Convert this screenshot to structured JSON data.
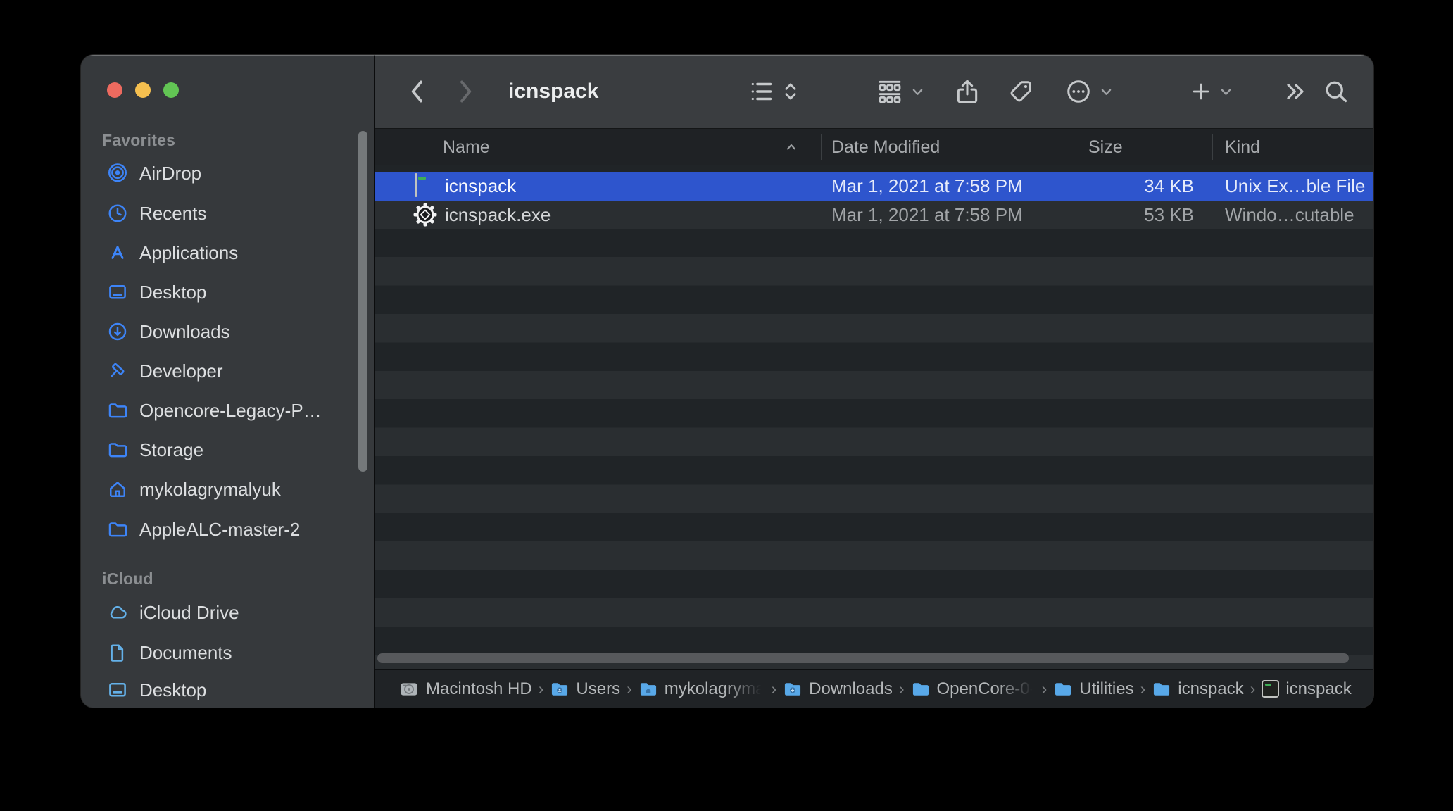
{
  "window": {
    "title": "icnspack"
  },
  "toolbar": {
    "back_icon": "chevron-left",
    "forward_icon": "chevron-right",
    "icons": [
      "list-view",
      "sort-direction",
      "group-by",
      "share",
      "tag",
      "more-actions",
      "new-item",
      "overflow",
      "search"
    ]
  },
  "sidebar": {
    "sections": [
      {
        "title": "Favorites",
        "items": [
          {
            "label": "AirDrop",
            "icon": "airdrop-icon"
          },
          {
            "label": "Recents",
            "icon": "clock-icon"
          },
          {
            "label": "Applications",
            "icon": "appstore-icon"
          },
          {
            "label": "Desktop",
            "icon": "desktop-icon"
          },
          {
            "label": "Downloads",
            "icon": "downloads-icon"
          },
          {
            "label": "Developer",
            "icon": "hammer-icon"
          },
          {
            "label": "Opencore-Legacy-P…",
            "icon": "folder-icon"
          },
          {
            "label": "Storage",
            "icon": "folder-icon"
          },
          {
            "label": "mykolagrymalyuk",
            "icon": "home-icon"
          },
          {
            "label": "AppleALC-master-2",
            "icon": "folder-icon"
          }
        ]
      },
      {
        "title": "iCloud",
        "items": [
          {
            "label": "iCloud Drive",
            "icon": "cloud-icon"
          },
          {
            "label": "Documents",
            "icon": "document-icon"
          },
          {
            "label": "Desktop",
            "icon": "desktop-icon"
          }
        ]
      }
    ]
  },
  "list": {
    "columns": [
      {
        "label": "Name"
      },
      {
        "label": "Date Modified"
      },
      {
        "label": "Size"
      },
      {
        "label": "Kind"
      }
    ],
    "sort_column": "Name",
    "sort_direction": "ascending",
    "rows": [
      {
        "name": "icnspack",
        "date_modified": "Mar 1, 2021 at 7:58 PM",
        "size": "34 KB",
        "kind": "Unix Ex…ble File",
        "icon": "terminal-file-icon",
        "selected": true
      },
      {
        "name": "icnspack.exe",
        "date_modified": "Mar 1, 2021 at 7:58 PM",
        "size": "53 KB",
        "kind": "Windo…cutable",
        "icon": "exe-gear-icon",
        "selected": false
      }
    ]
  },
  "path_bar": {
    "separator": "›",
    "items": [
      {
        "label": "Macintosh HD",
        "icon": "hard-drive-icon"
      },
      {
        "label": "Users",
        "icon": "folder-icon"
      },
      {
        "label": "mykolagryma",
        "icon": "folder-icon",
        "truncated": true
      },
      {
        "label": "Downloads",
        "icon": "folder-icon"
      },
      {
        "label": "OpenCore-0-",
        "icon": "folder-icon",
        "truncated": true
      },
      {
        "label": "Utilities",
        "icon": "folder-icon"
      },
      {
        "label": "icnspack",
        "icon": "folder-icon"
      },
      {
        "label": "icnspack",
        "icon": "terminal-file-icon"
      }
    ]
  },
  "colors": {
    "selection_blue": "#2e55cd",
    "sidebar_icon_blue": "#3d84f7",
    "icloud_icon_blue": "#64b1e9",
    "traffic_red": "#ed6a5f",
    "traffic_yellow": "#f5bf4f",
    "traffic_green": "#62c554",
    "window_chrome": "#3a3d40",
    "list_dark_stripe": "#202427",
    "list_light_stripe": "#2a2e31"
  }
}
